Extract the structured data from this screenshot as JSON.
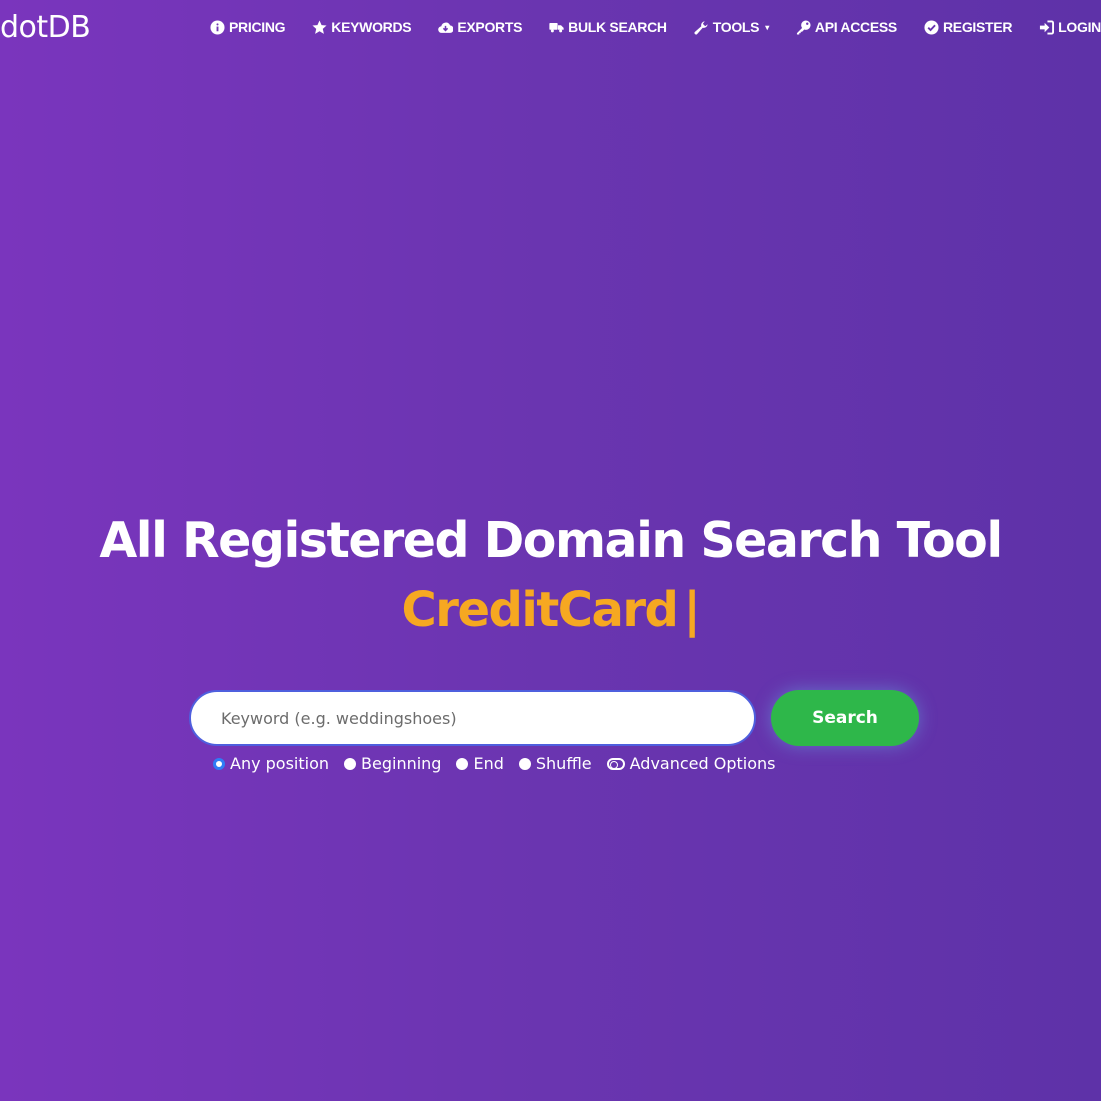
{
  "header": {
    "logo": "dotDB",
    "nav": [
      {
        "label": "PRICING",
        "icon": "info-circle-icon"
      },
      {
        "label": "KEYWORDS",
        "icon": "star-icon"
      },
      {
        "label": "EXPORTS",
        "icon": "cloud-download-icon"
      },
      {
        "label": "BULK SEARCH",
        "icon": "truck-icon"
      },
      {
        "label": "TOOLS",
        "icon": "wrench-icon",
        "dropdown": true
      },
      {
        "label": "API ACCESS",
        "icon": "key-icon"
      },
      {
        "label": "REGISTER",
        "icon": "check-circle-icon"
      },
      {
        "label": "LOGIN",
        "icon": "sign-in-icon"
      }
    ]
  },
  "hero": {
    "title": "All Registered Domain Search Tool",
    "typed_text": "CreditCard",
    "cursor": "|"
  },
  "search": {
    "placeholder": "Keyword (e.g. weddingshoes)",
    "value": "",
    "button_label": "Search"
  },
  "options": {
    "selected": "Any position",
    "items": [
      "Any position",
      "Beginning",
      "End",
      "Shuffle"
    ],
    "advanced_label": "Advanced Options"
  },
  "colors": {
    "background_start": "#7a35bd",
    "background_end": "#5e32a8",
    "accent": "#f6a821",
    "search_button": "#2eb74a"
  }
}
